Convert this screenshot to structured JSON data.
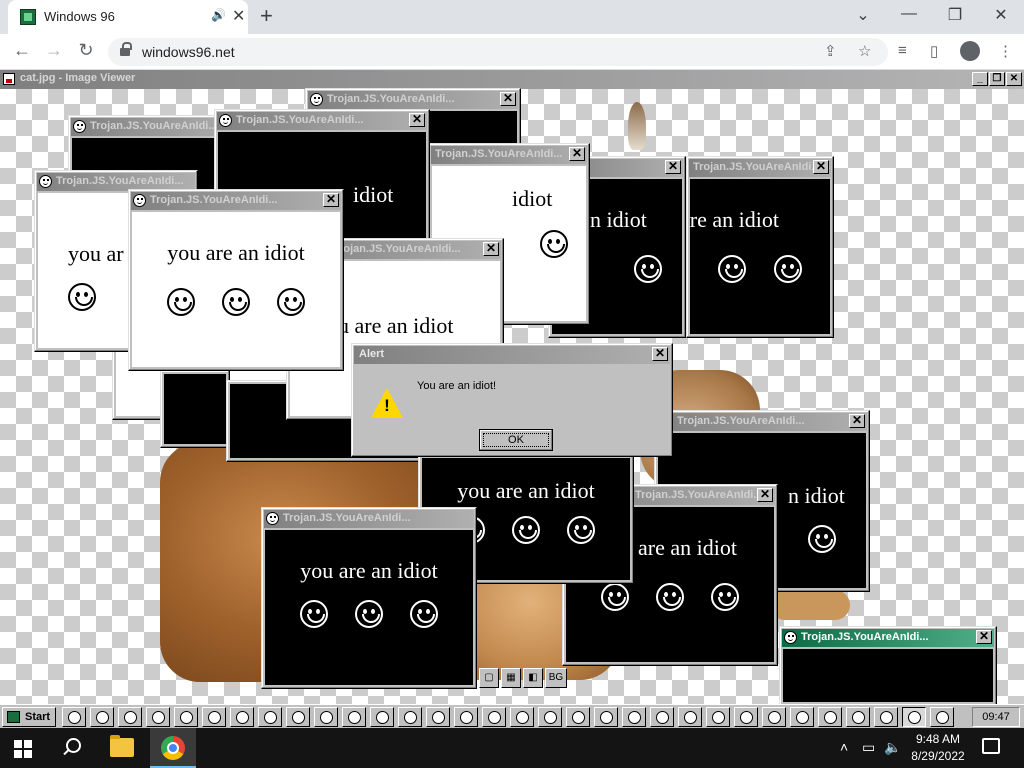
{
  "browser": {
    "tab_title": "Windows 96",
    "tab_audio_icon": "speaker-icon",
    "new_tab_glyph": "+",
    "url": "windows96.net",
    "window_controls": [
      "⌄",
      "—",
      "❐",
      "✕"
    ]
  },
  "viewer": {
    "title": "cat.jpg - Image Viewer",
    "controls": [
      "_",
      "❐",
      "✕"
    ],
    "bottom_controls": [
      "▢",
      "▦",
      "◧",
      "BG"
    ]
  },
  "popup": {
    "title": "Trojan.JS.YouAreAnIdi...",
    "message": "you are an idiot",
    "message_partial_1": "you ar",
    "message_partial_2": "u are an idiot",
    "message_partial_3": "are an idiot",
    "message_partial_4": "n idiot",
    "message_partial_5": "idiot",
    "close": "✕"
  },
  "alert": {
    "title": "Alert",
    "message": "You are an idiot!",
    "ok_label": "OK",
    "close": "✕"
  },
  "w96_taskbar": {
    "start_label": "Start",
    "clock": "09:47",
    "task_count": 32
  },
  "os_taskbar": {
    "time": "9:48 AM",
    "date": "8/29/2022"
  },
  "colors": {
    "active_title": "#0b6b45",
    "warning": "#ffd700"
  }
}
